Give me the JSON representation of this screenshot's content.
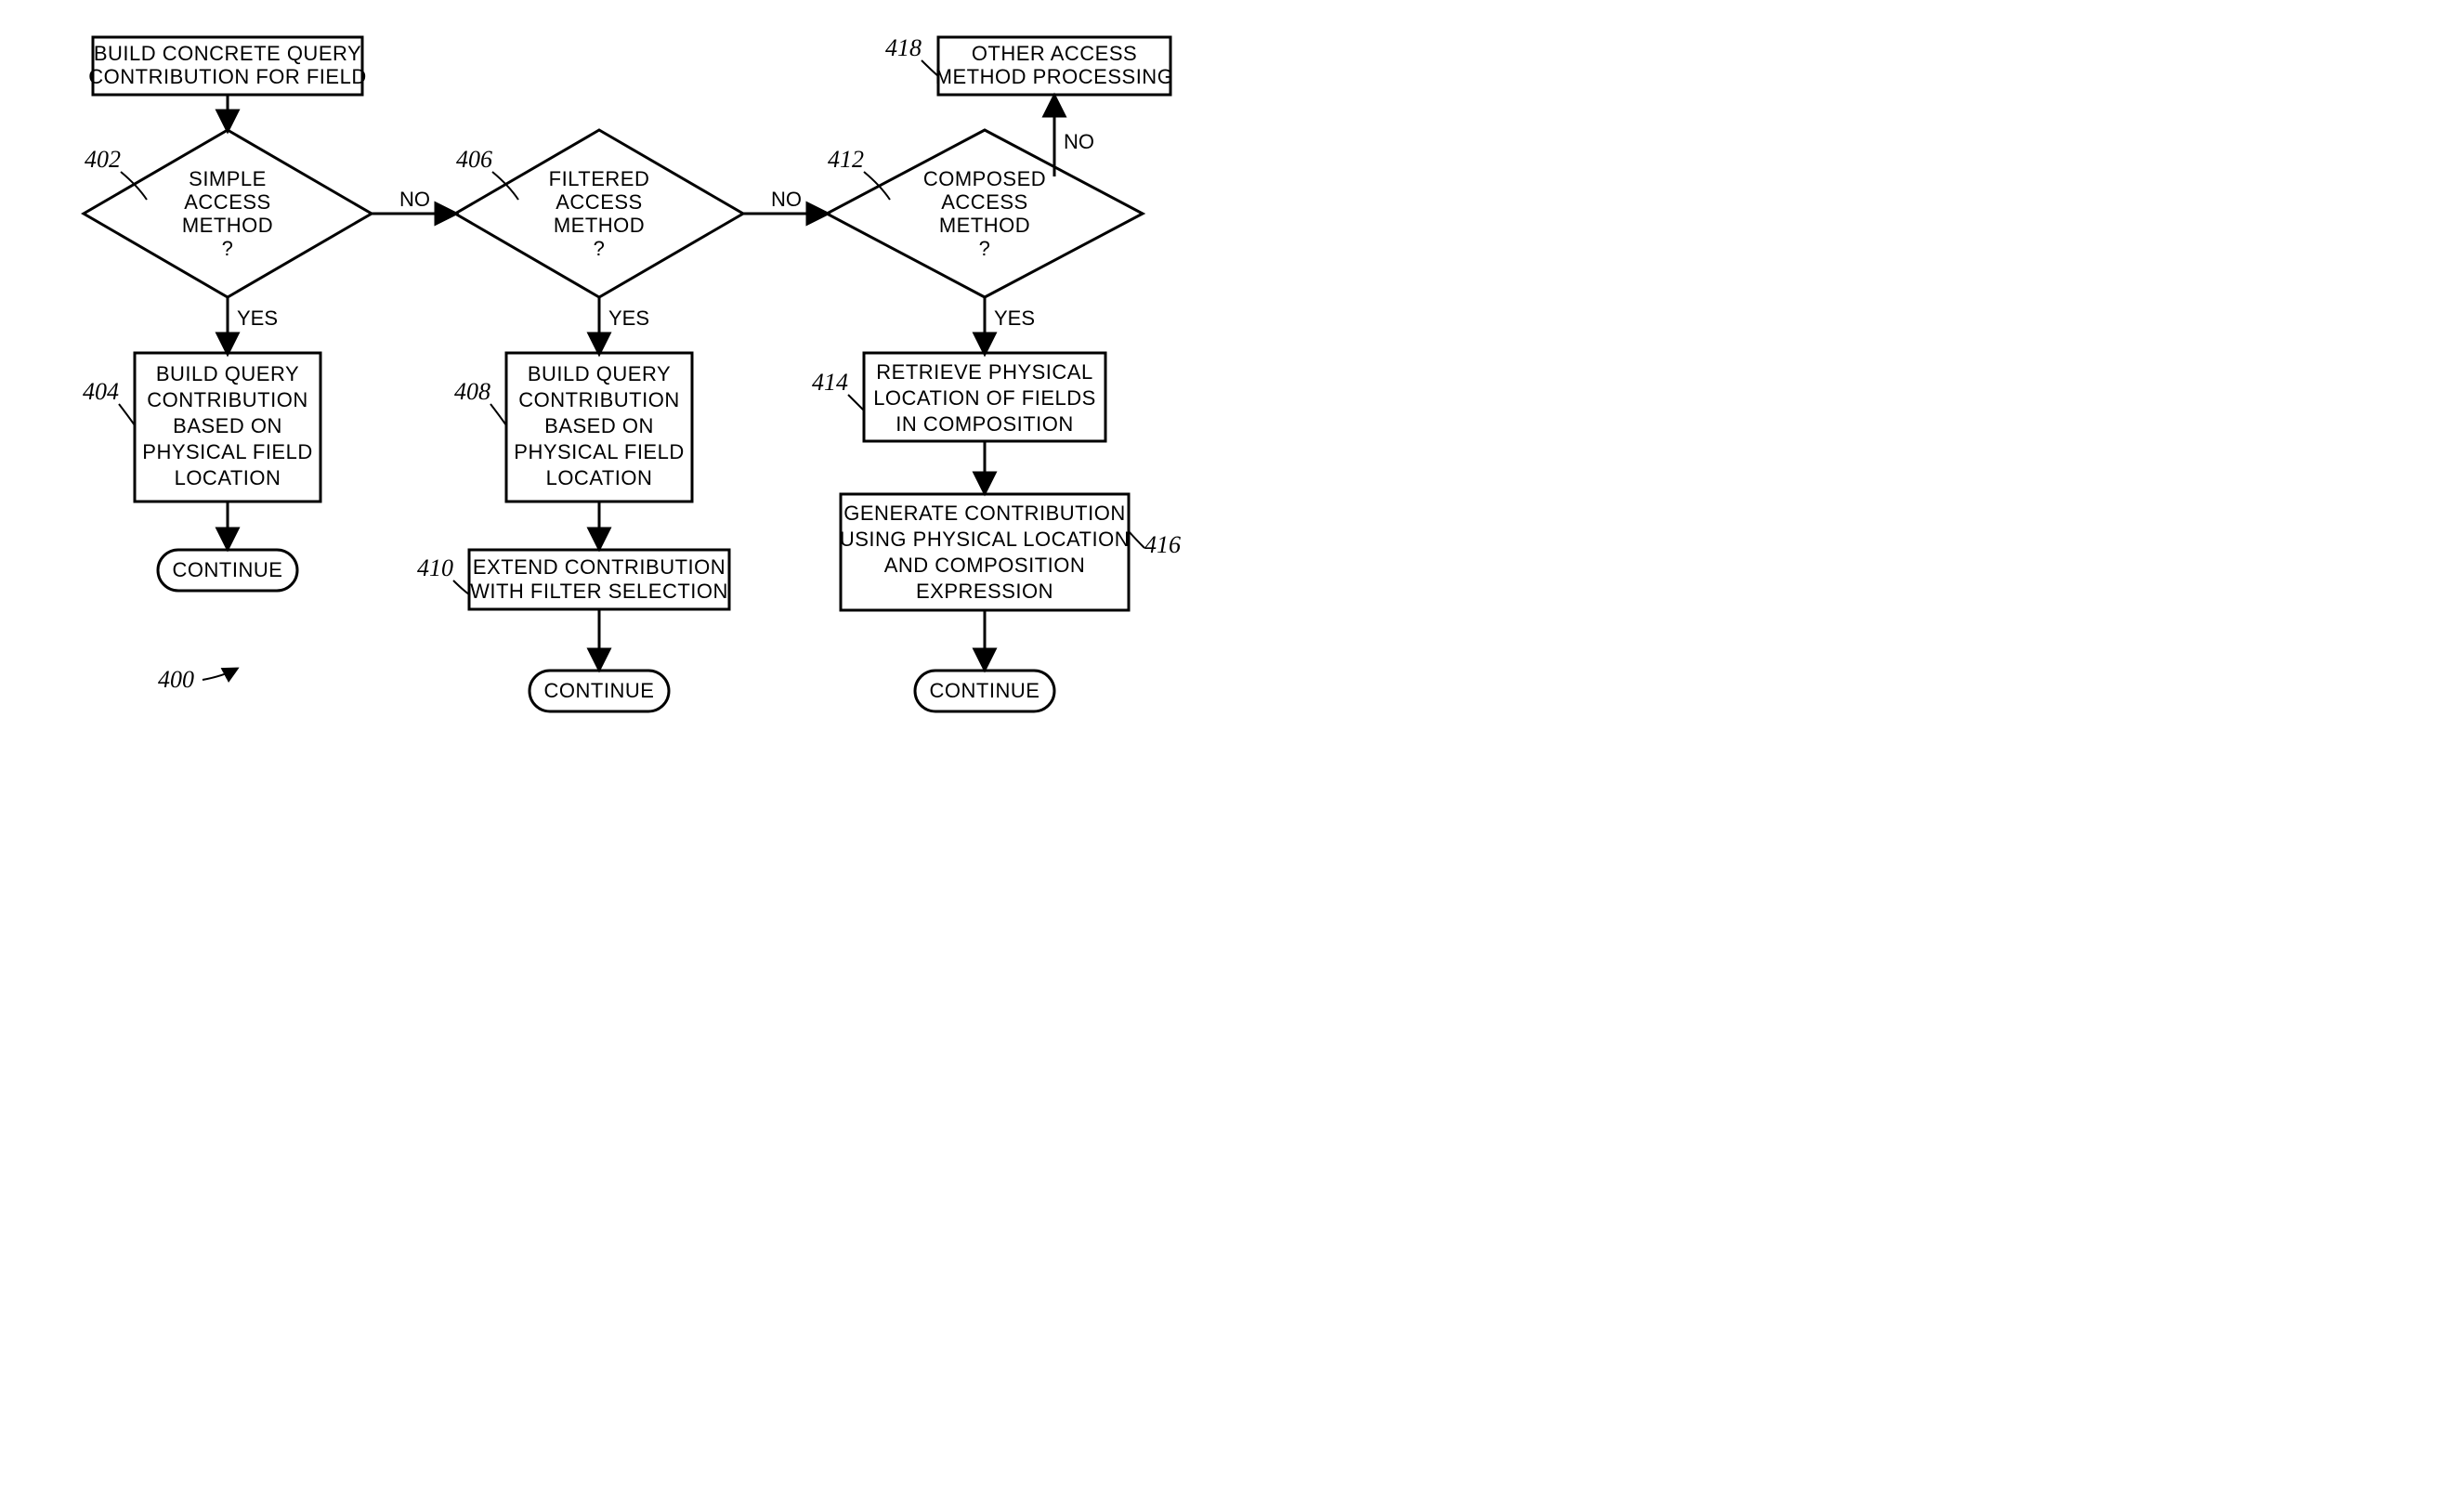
{
  "chart_data": {
    "type": "flowchart",
    "title": "",
    "nodes": [
      {
        "id": "start",
        "type": "process",
        "text": "BUILD CONCRETE QUERY CONTRIBUTION FOR FIELD"
      },
      {
        "id": "402",
        "type": "decision",
        "label": "402",
        "text": "SIMPLE ACCESS METHOD ?"
      },
      {
        "id": "404",
        "type": "process",
        "label": "404",
        "text": "BUILD QUERY CONTRIBUTION BASED ON PHYSICAL FIELD LOCATION"
      },
      {
        "id": "406",
        "type": "decision",
        "label": "406",
        "text": "FILTERED ACCESS METHOD ?"
      },
      {
        "id": "408",
        "type": "process",
        "label": "408",
        "text": "BUILD QUERY CONTRIBUTION BASED ON PHYSICAL FIELD LOCATION"
      },
      {
        "id": "410",
        "type": "process",
        "label": "410",
        "text": "EXTEND CONTRIBUTION WITH FILTER SELECTION"
      },
      {
        "id": "412",
        "type": "decision",
        "label": "412",
        "text": "COMPOSED ACCESS METHOD ?"
      },
      {
        "id": "414",
        "type": "process",
        "label": "414",
        "text": "RETRIEVE PHYSICAL LOCATION OF FIELDS IN COMPOSITION"
      },
      {
        "id": "416",
        "type": "process",
        "label": "416",
        "text": "GENERATE CONTRIBUTION USING PHYSICAL LOCATION AND COMPOSITION EXPRESSION"
      },
      {
        "id": "418",
        "type": "process",
        "label": "418",
        "text": "OTHER ACCESS METHOD PROCESSING"
      },
      {
        "id": "c1",
        "type": "terminator",
        "text": "CONTINUE"
      },
      {
        "id": "c2",
        "type": "terminator",
        "text": "CONTINUE"
      },
      {
        "id": "c3",
        "type": "terminator",
        "text": "CONTINUE"
      }
    ],
    "edges": [
      {
        "from": "start",
        "to": "402"
      },
      {
        "from": "402",
        "to": "404",
        "label": "YES"
      },
      {
        "from": "402",
        "to": "406",
        "label": "NO"
      },
      {
        "from": "404",
        "to": "c1"
      },
      {
        "from": "406",
        "to": "408",
        "label": "YES"
      },
      {
        "from": "406",
        "to": "412",
        "label": "NO"
      },
      {
        "from": "408",
        "to": "410"
      },
      {
        "from": "410",
        "to": "c2"
      },
      {
        "from": "412",
        "to": "414",
        "label": "YES"
      },
      {
        "from": "412",
        "to": "418",
        "label": "NO"
      },
      {
        "from": "414",
        "to": "416"
      },
      {
        "from": "416",
        "to": "c3"
      }
    ],
    "figure_label": "400"
  },
  "nodes": {
    "start": {
      "l1": "BUILD CONCRETE QUERY",
      "l2": "CONTRIBUTION FOR FIELD"
    },
    "n402": {
      "l1": "SIMPLE",
      "l2": "ACCESS",
      "l3": "METHOD",
      "l4": "?"
    },
    "n404": {
      "l1": "BUILD QUERY",
      "l2": "CONTRIBUTION",
      "l3": "BASED ON",
      "l4": "PHYSICAL FIELD",
      "l5": "LOCATION"
    },
    "n406": {
      "l1": "FILTERED",
      "l2": "ACCESS",
      "l3": "METHOD",
      "l4": "?"
    },
    "n408": {
      "l1": "BUILD QUERY",
      "l2": "CONTRIBUTION",
      "l3": "BASED ON",
      "l4": "PHYSICAL FIELD",
      "l5": "LOCATION"
    },
    "n410": {
      "l1": "EXTEND CONTRIBUTION",
      "l2": "WITH FILTER SELECTION"
    },
    "n412": {
      "l1": "COMPOSED",
      "l2": "ACCESS",
      "l3": "METHOD",
      "l4": "?"
    },
    "n414": {
      "l1": "RETRIEVE PHYSICAL",
      "l2": "LOCATION OF FIELDS",
      "l3": "IN COMPOSITION"
    },
    "n416": {
      "l1": "GENERATE CONTRIBUTION",
      "l2": "USING PHYSICAL LOCATION",
      "l3": "AND COMPOSITION",
      "l4": "EXPRESSION"
    },
    "n418": {
      "l1": "OTHER ACCESS",
      "l2": "METHOD PROCESSING"
    },
    "c1": "CONTINUE",
    "c2": "CONTINUE",
    "c3": "CONTINUE"
  },
  "labels": {
    "n402": "402",
    "n404": "404",
    "n406": "406",
    "n408": "408",
    "n410": "410",
    "n412": "412",
    "n414": "414",
    "n416": "416",
    "n418": "418",
    "fig": "400"
  },
  "edgeLabels": {
    "yes": "YES",
    "no": "NO"
  }
}
